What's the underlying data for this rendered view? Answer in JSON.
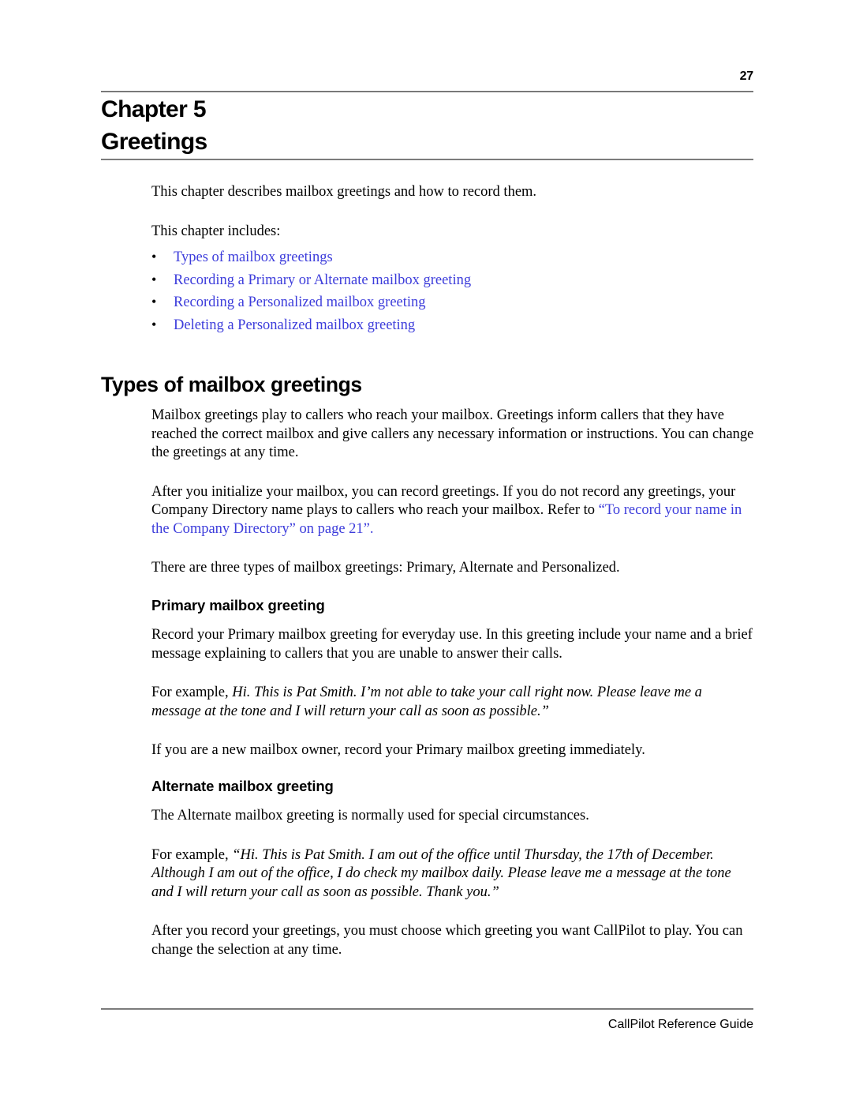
{
  "document": {
    "page_number": "27",
    "footer": "CallPilot Reference Guide"
  },
  "chapter": {
    "label": "Chapter 5",
    "title": "Greetings"
  },
  "intro": {
    "paragraph_1": "This chapter describes mailbox greetings and how to record them.",
    "paragraph_2": "This chapter includes:",
    "bullet_glyph": "•",
    "links": [
      "Types of mailbox greetings",
      "Recording a Primary or Alternate mailbox greeting",
      "Recording a Personalized mailbox greeting",
      "Deleting a Personalized mailbox greeting"
    ]
  },
  "section": {
    "heading": "Types of mailbox greetings",
    "paragraph_1": "Mailbox greetings play to callers who reach your mailbox. Greetings inform callers that they have reached the correct mailbox and give callers any necessary information or instructions. You can change the greetings at any time.",
    "paragraph_2_before": "After you initialize your mailbox, you can record greetings. If you do not record any greetings, your Company Directory name plays to callers who reach your mailbox. Refer to ",
    "paragraph_2_xref": "“To record your name in the Company Directory” on page 21”.",
    "paragraph_3": "There are three types of mailbox greetings: Primary, Alternate and Personalized."
  },
  "primary": {
    "heading": "Primary mailbox greeting",
    "paragraph_1": "Record your Primary mailbox greeting for everyday use. In this greeting include your name and a brief message explaining to callers that you are unable to answer their calls.",
    "example_lead": "For example, ",
    "example_text": "Hi. This is Pat Smith. I’m not able to take your call right now. Please leave me a message at the tone and I will return your call as soon as possible.”",
    "paragraph_2": "If you are a new mailbox owner, record your Primary mailbox greeting immediately."
  },
  "alternate": {
    "heading": "Alternate mailbox greeting",
    "paragraph_1": "The Alternate mailbox greeting is normally used for special circumstances.",
    "example_lead": "For example, ",
    "example_text": "“Hi. This is Pat Smith. I am out of the office until Thursday, the 17th of December. Although I am out of the office, I do check my mailbox daily. Please leave me a message at the tone and I will return your call as soon as possible. Thank you.”",
    "paragraph_2": "After you record your greetings, you must choose which greeting you want CallPilot to play. You can change the selection at any time."
  },
  "colors": {
    "link": "#3c3cdb",
    "rule": "#8a8a8a",
    "text": "#000000",
    "background": "#ffffff"
  }
}
